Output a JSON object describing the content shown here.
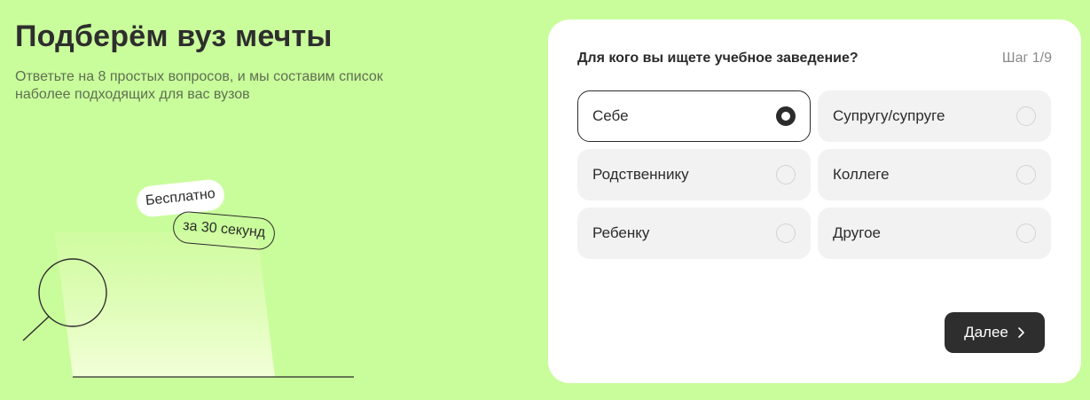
{
  "promo": {
    "title": "Подберём вуз мечты",
    "subtitle": "Ответьте на 8 простых вопросов, и мы составим список наболее подходящих для вас вузов",
    "badge_free": "Бесплатно",
    "badge_time": "за 30 секунд",
    "illustration_icon": "magnifier-icon"
  },
  "quiz": {
    "question": "Для кого вы ищете учебное заведение?",
    "step": "Шаг 1/9",
    "options": [
      {
        "label": "Себе",
        "selected": true
      },
      {
        "label": "Супругу/супруге",
        "selected": false
      },
      {
        "label": "Родственнику",
        "selected": false
      },
      {
        "label": "Коллеге",
        "selected": false
      },
      {
        "label": "Ребенку",
        "selected": false
      },
      {
        "label": "Другое",
        "selected": false
      }
    ],
    "next_label": "Далее",
    "next_icon": "chevron-right-icon"
  },
  "colors": {
    "background": "#c9fd9b",
    "card": "#ffffff",
    "accent_dark": "#2e2e2e",
    "option_bg": "#f2f2f2"
  }
}
